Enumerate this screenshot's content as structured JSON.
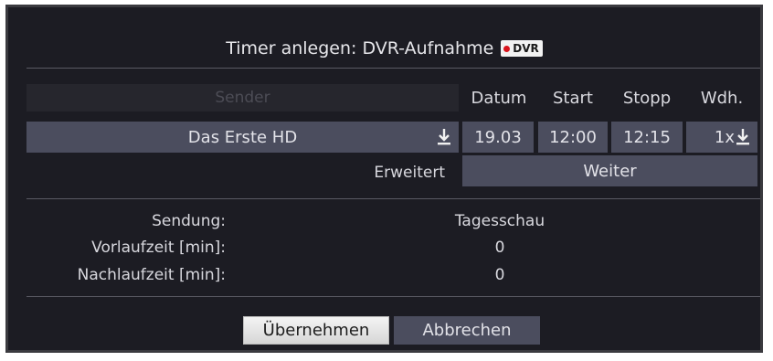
{
  "dialog": {
    "title": "Timer anlegen: DVR-Aufnahme",
    "badge_label": "DVR"
  },
  "headers": {
    "sender": "Sender",
    "datum": "Datum",
    "start": "Start",
    "stopp": "Stopp",
    "wdh": "Wdh."
  },
  "fields": {
    "sender": "Das Erste HD",
    "datum": "19.03",
    "start": "12:00",
    "stopp": "12:15",
    "wdh": "1x"
  },
  "extended": {
    "label": "Erweitert",
    "value": "Weiter"
  },
  "info": {
    "sendung_label": "Sendung:",
    "sendung_value": "Tagesschau",
    "vorlauf_label": "Vorlaufzeit [min]:",
    "vorlauf_value": "0",
    "nachlauf_label": "Nachlaufzeit [min]:",
    "nachlauf_value": "0"
  },
  "buttons": {
    "ok": "Übernehmen",
    "cancel": "Abbrechen"
  },
  "icons": {
    "sender_dropdown": "download-arrow-icon",
    "wdh_dropdown": "download-arrow-icon",
    "record": "record-dot-icon"
  },
  "colors": {
    "background": "#1c1c23",
    "field": "#4b4d5e",
    "record_red": "#d9141c"
  }
}
